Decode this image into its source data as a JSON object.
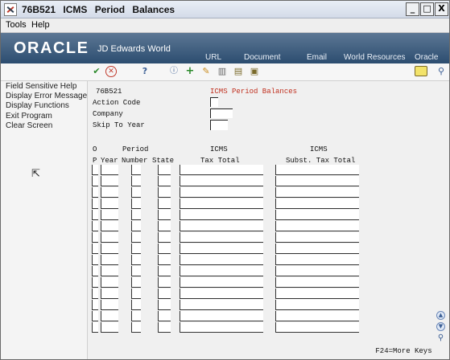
{
  "window": {
    "title_id": "76B521",
    "title": "ICMS Period Balances",
    "controls": {
      "minimize": "_",
      "maximize": "□",
      "close": "X"
    }
  },
  "menubar": {
    "items": [
      "Tools",
      "Help"
    ]
  },
  "banner": {
    "logo": "ORACLE",
    "product": "JD Edwards World",
    "links": [
      "URL",
      "Document",
      "Email",
      "World Resources",
      "Oracle"
    ]
  },
  "toolbar": {
    "icons": [
      "check-icon",
      "cancel-icon",
      "help-icon",
      "info-icon",
      "add-icon",
      "edit-icon",
      "delete-icon",
      "copy-icon",
      "paste-icon",
      "notes-icon",
      "search-icon"
    ],
    "help_label": "?"
  },
  "exits": [
    "Field Sensitive Help",
    "Display Error Message",
    "Display Functions",
    "Exit Program",
    "Clear Screen"
  ],
  "form": {
    "program_id": "76B521",
    "screen_title": "ICMS Period Balances",
    "fields": {
      "action_code": {
        "label": "Action Code",
        "value": ""
      },
      "company": {
        "label": "Company",
        "value": ""
      },
      "skip_to_year": {
        "label": "Skip To Year",
        "value": ""
      }
    },
    "headers_line1": {
      "o": "O",
      "period": "Period",
      "icms": "ICMS",
      "icms2": "ICMS"
    },
    "headers_line2": {
      "p": "P",
      "year": "Year",
      "number": "Number",
      "state": "State",
      "tax_total": "Tax Total",
      "subst_tax_total": "Subst. Tax Total"
    },
    "rows": 15,
    "footer": "F24=More Keys"
  }
}
